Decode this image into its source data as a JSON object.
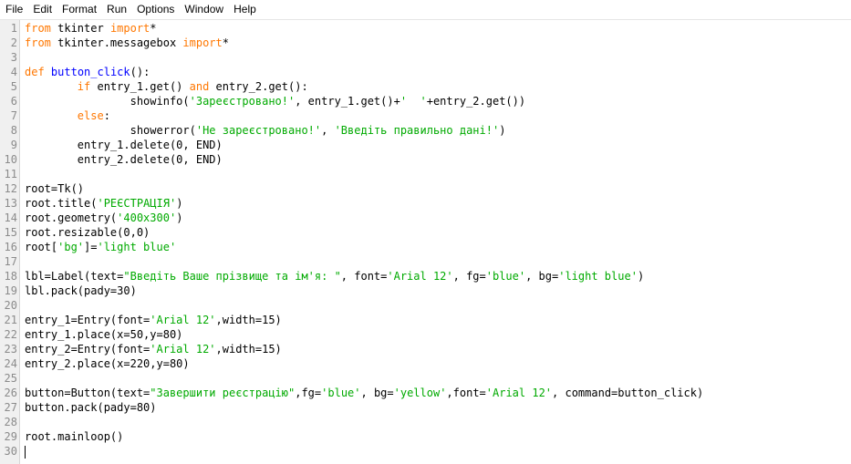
{
  "colors": {
    "keyword": "#ff7700",
    "string": "#00aa00",
    "definition": "#0000ff",
    "text": "#000000",
    "line_number": "#8b8b8b"
  },
  "menu": [
    "File",
    "Edit",
    "Format",
    "Run",
    "Options",
    "Window",
    "Help"
  ],
  "lines": [
    {
      "n": "1",
      "tokens": [
        {
          "t": "from",
          "c": "kw"
        },
        {
          "t": " tkinter ",
          "c": "txt"
        },
        {
          "t": "import",
          "c": "kw"
        },
        {
          "t": "*",
          "c": "txt"
        }
      ]
    },
    {
      "n": "2",
      "tokens": [
        {
          "t": "from",
          "c": "kw"
        },
        {
          "t": " tkinter.messagebox ",
          "c": "txt"
        },
        {
          "t": "import",
          "c": "kw"
        },
        {
          "t": "*",
          "c": "txt"
        }
      ]
    },
    {
      "n": "3",
      "tokens": []
    },
    {
      "n": "4",
      "tokens": [
        {
          "t": "def",
          "c": "kw"
        },
        {
          "t": " ",
          "c": "txt"
        },
        {
          "t": "button_click",
          "c": "def"
        },
        {
          "t": "():",
          "c": "txt"
        }
      ]
    },
    {
      "n": "5",
      "tokens": [
        {
          "t": "        ",
          "c": "txt"
        },
        {
          "t": "if",
          "c": "kw"
        },
        {
          "t": " entry_1.get() ",
          "c": "txt"
        },
        {
          "t": "and",
          "c": "kw"
        },
        {
          "t": " entry_2.get():",
          "c": "txt"
        }
      ]
    },
    {
      "n": "6",
      "tokens": [
        {
          "t": "                showinfo(",
          "c": "txt"
        },
        {
          "t": "'Зареєстровано!'",
          "c": "str"
        },
        {
          "t": ", entry_1.get()+",
          "c": "txt"
        },
        {
          "t": "'  '",
          "c": "str"
        },
        {
          "t": "+entry_2.get())",
          "c": "txt"
        }
      ]
    },
    {
      "n": "7",
      "tokens": [
        {
          "t": "        ",
          "c": "txt"
        },
        {
          "t": "else",
          "c": "kw"
        },
        {
          "t": ":",
          "c": "txt"
        }
      ]
    },
    {
      "n": "8",
      "tokens": [
        {
          "t": "                showerror(",
          "c": "txt"
        },
        {
          "t": "'Не зареєстровано!'",
          "c": "str"
        },
        {
          "t": ", ",
          "c": "txt"
        },
        {
          "t": "'Введіть правильно дані!'",
          "c": "str"
        },
        {
          "t": ")",
          "c": "txt"
        }
      ]
    },
    {
      "n": "9",
      "tokens": [
        {
          "t": "        entry_1.delete(0, END)",
          "c": "txt"
        }
      ]
    },
    {
      "n": "10",
      "tokens": [
        {
          "t": "        entry_2.delete(0, END)",
          "c": "txt"
        }
      ]
    },
    {
      "n": "11",
      "tokens": []
    },
    {
      "n": "12",
      "tokens": [
        {
          "t": "root=Tk()",
          "c": "txt"
        }
      ]
    },
    {
      "n": "13",
      "tokens": [
        {
          "t": "root.title(",
          "c": "txt"
        },
        {
          "t": "'РЕЄСТРАЦІЯ'",
          "c": "str"
        },
        {
          "t": ")",
          "c": "txt"
        }
      ]
    },
    {
      "n": "14",
      "tokens": [
        {
          "t": "root.geometry(",
          "c": "txt"
        },
        {
          "t": "'400x300'",
          "c": "str"
        },
        {
          "t": ")",
          "c": "txt"
        }
      ]
    },
    {
      "n": "15",
      "tokens": [
        {
          "t": "root.resizable(0,0)",
          "c": "txt"
        }
      ]
    },
    {
      "n": "16",
      "tokens": [
        {
          "t": "root[",
          "c": "txt"
        },
        {
          "t": "'bg'",
          "c": "str"
        },
        {
          "t": "]=",
          "c": "txt"
        },
        {
          "t": "'light blue'",
          "c": "str"
        }
      ]
    },
    {
      "n": "17",
      "tokens": []
    },
    {
      "n": "18",
      "tokens": [
        {
          "t": "lbl=Label(text=",
          "c": "txt"
        },
        {
          "t": "\"Введіть Ваше прізвище та ім'я: \"",
          "c": "str"
        },
        {
          "t": ", font=",
          "c": "txt"
        },
        {
          "t": "'Arial 12'",
          "c": "str"
        },
        {
          "t": ", fg=",
          "c": "txt"
        },
        {
          "t": "'blue'",
          "c": "str"
        },
        {
          "t": ", bg=",
          "c": "txt"
        },
        {
          "t": "'light blue'",
          "c": "str"
        },
        {
          "t": ")",
          "c": "txt"
        }
      ]
    },
    {
      "n": "19",
      "tokens": [
        {
          "t": "lbl.pack(pady=30)",
          "c": "txt"
        }
      ]
    },
    {
      "n": "20",
      "tokens": []
    },
    {
      "n": "21",
      "tokens": [
        {
          "t": "entry_1=Entry(font=",
          "c": "txt"
        },
        {
          "t": "'Arial 12'",
          "c": "str"
        },
        {
          "t": ",width=15)",
          "c": "txt"
        }
      ]
    },
    {
      "n": "22",
      "tokens": [
        {
          "t": "entry_1.place(x=50,y=80)",
          "c": "txt"
        }
      ]
    },
    {
      "n": "23",
      "tokens": [
        {
          "t": "entry_2=Entry(font=",
          "c": "txt"
        },
        {
          "t": "'Arial 12'",
          "c": "str"
        },
        {
          "t": ",width=15)",
          "c": "txt"
        }
      ]
    },
    {
      "n": "24",
      "tokens": [
        {
          "t": "entry_2.place(x=220,y=80)",
          "c": "txt"
        }
      ]
    },
    {
      "n": "25",
      "tokens": []
    },
    {
      "n": "26",
      "tokens": [
        {
          "t": "button=Button(text=",
          "c": "txt"
        },
        {
          "t": "\"Завершити реєстрацію\"",
          "c": "str"
        },
        {
          "t": ",fg=",
          "c": "txt"
        },
        {
          "t": "'blue'",
          "c": "str"
        },
        {
          "t": ", bg=",
          "c": "txt"
        },
        {
          "t": "'yellow'",
          "c": "str"
        },
        {
          "t": ",font=",
          "c": "txt"
        },
        {
          "t": "'Arial 12'",
          "c": "str"
        },
        {
          "t": ", command=button_click)",
          "c": "txt"
        }
      ]
    },
    {
      "n": "27",
      "tokens": [
        {
          "t": "button.pack(pady=80)",
          "c": "txt"
        }
      ]
    },
    {
      "n": "28",
      "tokens": []
    },
    {
      "n": "29",
      "tokens": [
        {
          "t": "root.mainloop()",
          "c": "txt"
        }
      ]
    },
    {
      "n": "30",
      "tokens": []
    }
  ]
}
